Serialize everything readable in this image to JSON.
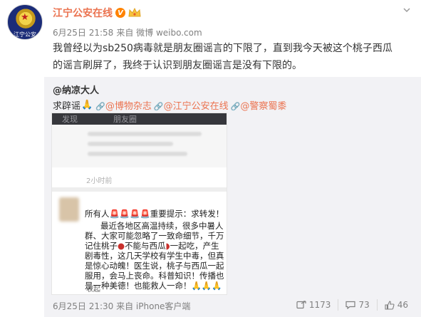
{
  "avatar": {
    "label": "江宁公安"
  },
  "author": {
    "name": "江宁公安在线"
  },
  "post_meta": {
    "time": "6月25日 21:58",
    "via": "来自 微博 weibo.com"
  },
  "post_text": "我曾经以为sb250病毒就是朋友圈谣言的下限了，直到我今天被这个桃子西瓜的谣言刷屏了，我终于认识到朋友圈谣言是没有下限的。",
  "repost": {
    "author": "@纳凉大人",
    "text_prefix": "求辟谣",
    "mentions": [
      "@博物杂志",
      "@江宁公安在线",
      "@警察蜀黍"
    ]
  },
  "screenshot": {
    "bar_back": "发现",
    "bar_title": "朋友圈",
    "time": "2小时前",
    "post_lead": "所有人",
    "post_alert": "重要提示：求转发！",
    "post_body": "最近各地区高温持续，很多中暑人群、大家可能忽略了一致命细节，千万记住桃子",
    "post_body2": "不能与西瓜",
    "post_body3": "一起吃，产生剧毒性，这几天学校有学生中毒，但真是惊心动魄！医生说，桃子与西瓜一起服用，会马上丧命。科普知识！传播也是一种美德！也能救人一命！",
    "foot": "收起"
  },
  "bottom": {
    "time": "6月25日 21:30 来自 iPhone客户端",
    "forward_count": "1173",
    "comment_count": "73",
    "like_count": "46"
  },
  "colors": {
    "name": "#eb7350",
    "repost_bg": "#f2f2f5",
    "vip": "#ff8200"
  },
  "icons": [
    "chevron-down-icon",
    "verified-v-icon",
    "crown-icon",
    "pray-icon",
    "link-icon",
    "forward-icon",
    "comment-icon",
    "like-icon"
  ]
}
